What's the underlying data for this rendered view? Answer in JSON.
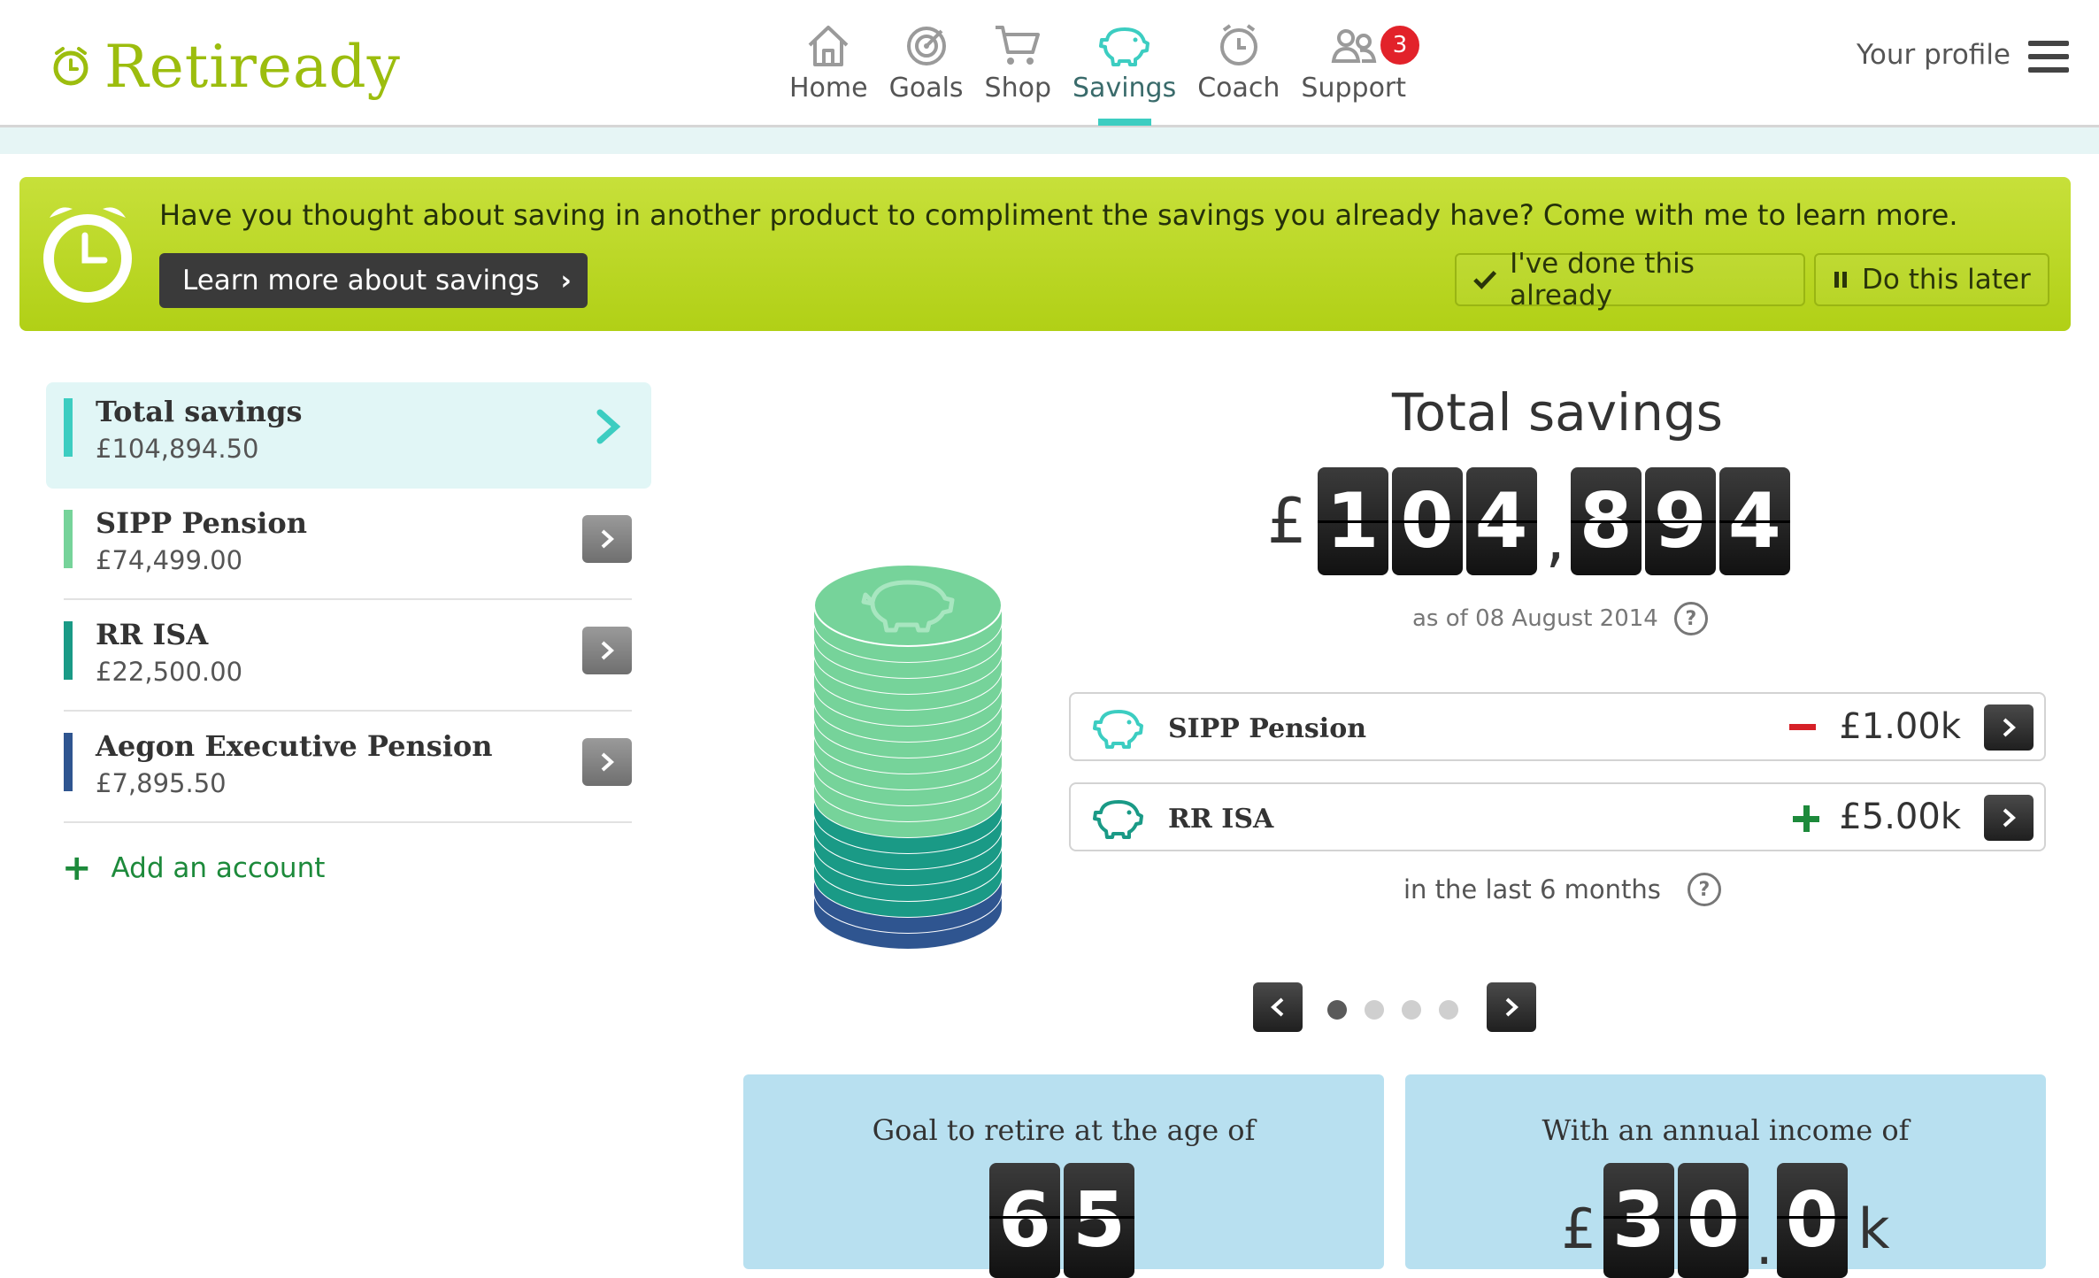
{
  "header": {
    "logo": "Retiready",
    "nav": [
      {
        "label": "Home",
        "icon": "home-icon"
      },
      {
        "label": "Goals",
        "icon": "target-icon"
      },
      {
        "label": "Shop",
        "icon": "cart-icon"
      },
      {
        "label": "Savings",
        "icon": "piggy-bank-icon",
        "active": true
      },
      {
        "label": "Coach",
        "icon": "clock-icon"
      },
      {
        "label": "Support",
        "icon": "people-icon",
        "badge": "3"
      }
    ],
    "profile_label": "Your profile"
  },
  "banner": {
    "message": "Have you thought about saving in another product to compliment the savings you already have? Come with me to learn more.",
    "learn_button": "Learn more about savings",
    "done_button": "I've done this already",
    "later_button": "Do this later"
  },
  "accounts": [
    {
      "name": "Total savings",
      "value": "£104,894.50",
      "color": "#3ccdc1",
      "selected": true
    },
    {
      "name": "SIPP Pension",
      "value": "£74,499.00",
      "color": "#76d39a"
    },
    {
      "name": "RR ISA",
      "value": "£22,500.00",
      "color": "#1a9a86"
    },
    {
      "name": "Aegon Executive Pension",
      "value": "£7,895.50",
      "color": "#2f5590"
    }
  ],
  "add_account": "Add an account",
  "summary": {
    "title": "Total savings",
    "currency": "£",
    "digits_group1": [
      "1",
      "0",
      "4"
    ],
    "separator": ",",
    "digits_group2": [
      "8",
      "9",
      "4"
    ],
    "as_of": "as of 08 August 2014"
  },
  "changes": [
    {
      "name": "SIPP Pension",
      "sign": "minus",
      "value": "£1.00k",
      "sign_color": "#d62027"
    },
    {
      "name": "RR ISA",
      "sign": "plus",
      "value": "£5.00k",
      "sign_color": "#1d8a3b"
    }
  ],
  "changes_period": "in the last 6 months",
  "pager": {
    "total": 4,
    "current": 1
  },
  "goals": {
    "age_label": "Goal to retire at the age of",
    "age_digits": [
      "6",
      "5"
    ],
    "income_label": "With an annual income of",
    "income_currency": "£",
    "income_digits": [
      "3",
      "0",
      "0"
    ],
    "income_decimal": ".",
    "income_suffix": "k"
  }
}
